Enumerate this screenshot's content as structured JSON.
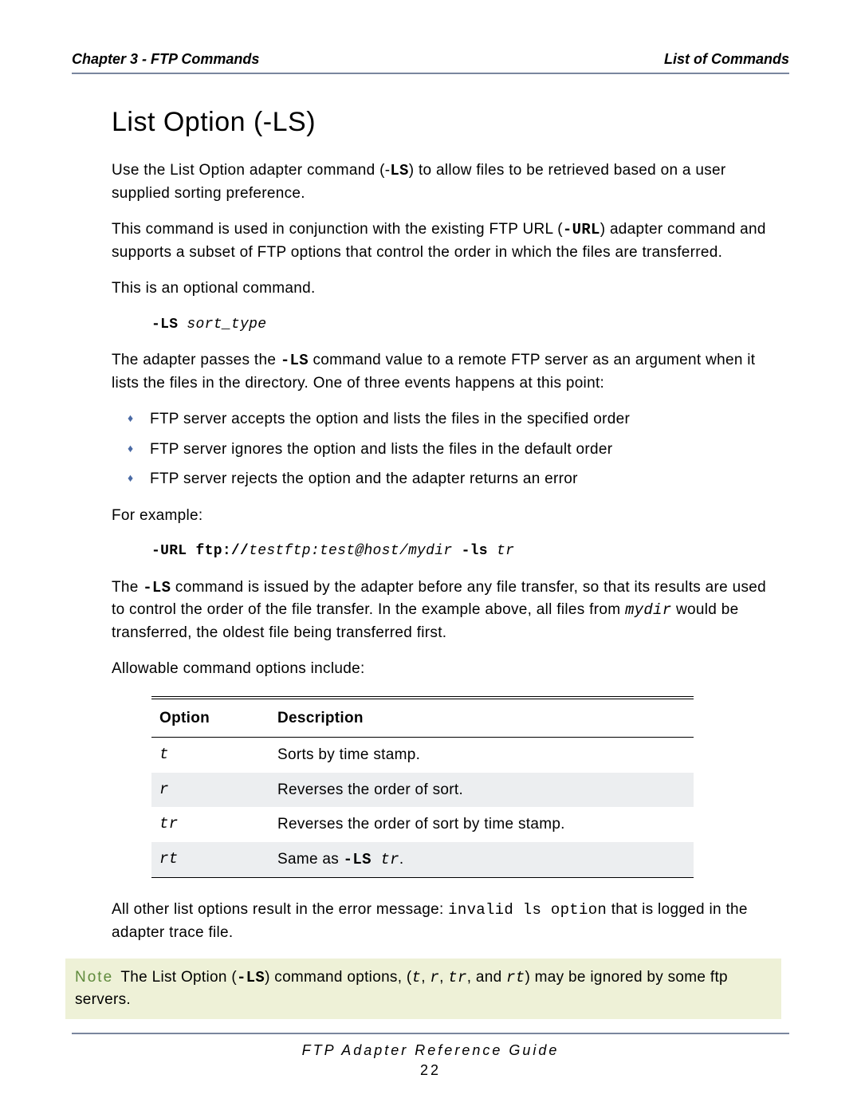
{
  "header": {
    "left": "Chapter 3 - FTP Commands",
    "right": "List of Commands"
  },
  "title": "List Option (-LS)",
  "p1_a": "Use the List Option adapter command (-",
  "p1_code": "LS",
  "p1_b": ") to allow files to be retrieved based on a user supplied sorting preference.",
  "p2_a": "This command is used in conjunction with the existing FTP URL (",
  "p2_code": "-URL",
  "p2_b": ") adapter command and supports a subset of FTP options that control the order in which the files are transferred.",
  "p3": "This is an optional command.",
  "syntax_cmd": "-LS",
  "syntax_arg": "sort_type",
  "p4_a": "The adapter passes the ",
  "p4_code": "-LS",
  "p4_b": " command value to a remote FTP server as an argument when it lists the files in the directory. One of three events happens at this point:",
  "bullets": [
    "FTP server accepts the option and lists the files in the specified order",
    "FTP server ignores the option and lists the files in the default order",
    "FTP server rejects the option and the adapter returns an error"
  ],
  "p5": "For example:",
  "example_prefix": "-URL ftp://",
  "example_mid": "testftp:test@host/mydir",
  "example_ls": " -ls ",
  "example_arg": "tr",
  "p6_a": "The ",
  "p6_code": "-LS",
  "p6_b": " command is issued by the adapter before any file transfer, so that its results are used to control the order of the file transfer. In the example above, all files from ",
  "p6_dir": "mydir",
  "p6_c": " would be transferred, the oldest file being transferred first.",
  "p7": "Allowable command options include:",
  "table": {
    "head_option": "Option",
    "head_desc": "Description",
    "rows": [
      {
        "opt": "t",
        "desc_plain": "Sorts by time stamp."
      },
      {
        "opt": "r",
        "desc_plain": "Reverses the order of sort."
      },
      {
        "opt": "tr",
        "desc_plain": "Reverses the order of sort by time stamp."
      },
      {
        "opt": "rt",
        "desc_prefix": "Same as ",
        "desc_code": "-LS",
        "desc_arg": " tr",
        "desc_suffix": "."
      }
    ]
  },
  "p8_a": "All other list options result in the error message: ",
  "p8_code": "invalid ls option",
  "p8_b": " that is logged in the adapter trace file.",
  "note": {
    "label": "Note",
    "a": "The List Option (",
    "code1": "-LS",
    "b": ") command options, (",
    "o1": "t",
    "c1": ", ",
    "o2": "r",
    "c2": ", ",
    "o3": "tr",
    "c3": ", and ",
    "o4": "rt",
    "d": ") may be ignored by some ftp servers."
  },
  "footer": {
    "title": "FTP Adapter Reference Guide",
    "page": "22"
  }
}
